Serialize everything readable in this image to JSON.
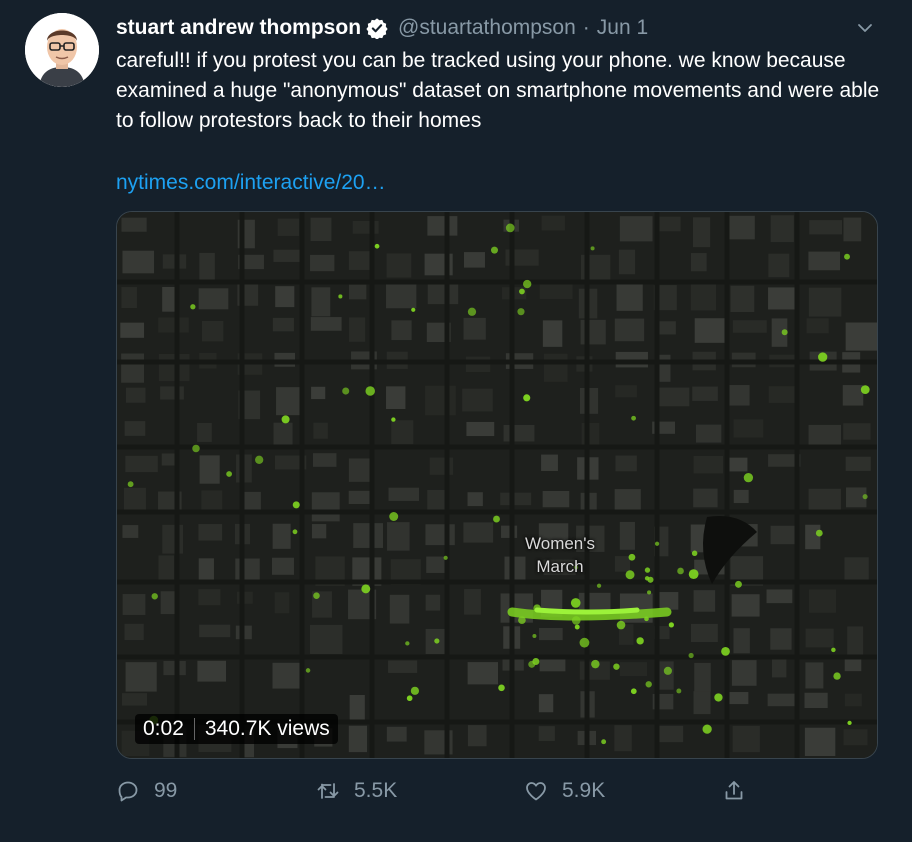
{
  "tweet": {
    "author_name": "stuart andrew thompson",
    "handle": "@stuartathompson",
    "separator": "·",
    "date": "Jun 1",
    "text": "careful!! if you protest you can be tracked using your phone. we know because examined a huge \"anonymous\" dataset on smartphone movements and were able to follow protestors back to their homes",
    "link_text": "nytimes.com/interactive/20…"
  },
  "media": {
    "overlay_label_line1": "Women's",
    "overlay_label_line2": "March",
    "elapsed": "0:02",
    "views": "340.7K views"
  },
  "actions": {
    "reply_count": "99",
    "retweet_count": "5.5K",
    "like_count": "5.9K"
  },
  "icons": {
    "verified": "verified-badge-icon",
    "menu": "chevron-down-icon",
    "reply": "reply-icon",
    "retweet": "retweet-icon",
    "like": "heart-icon",
    "share": "share-icon"
  },
  "colors": {
    "background": "#15202b",
    "text": "#ffffff",
    "secondary": "#8899a6",
    "link": "#1da1f2",
    "dots": "#7ed321"
  }
}
